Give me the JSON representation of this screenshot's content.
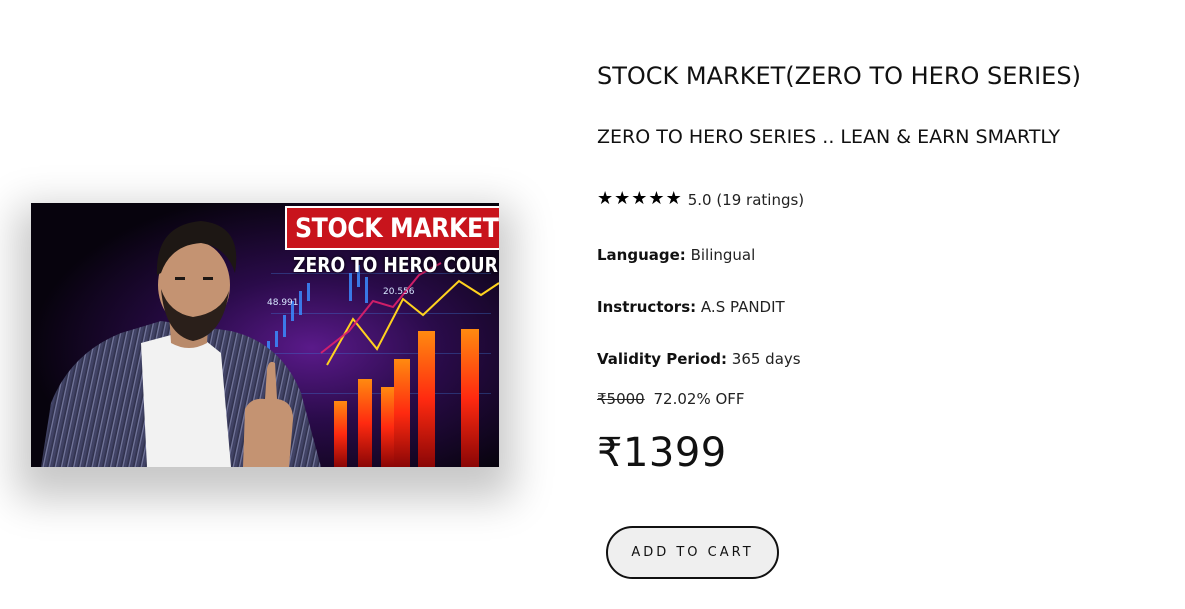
{
  "thumbnail": {
    "title": "STOCK MARKET",
    "subtitle": "ZERO TO HERO COURSE",
    "chart_numbers": [
      "48.991",
      "20.556"
    ],
    "colors": {
      "title_bg": "#c8141c",
      "background": "#0a0514",
      "bars": "#ff3a12",
      "line": "#ffd21e"
    }
  },
  "course": {
    "title": "STOCK MARKET(ZERO TO HERO SERIES)",
    "subtitle": "ZERO TO HERO SERIES .. LEAN & EARN SMARTLY",
    "rating": {
      "stars": 5,
      "text": "5.0 (19 ratings)",
      "star_icon": "★"
    },
    "language": {
      "label": "Language:",
      "value": "Bilingual"
    },
    "instructors": {
      "label": "Instructors:",
      "value": "A.S PANDIT"
    },
    "validity": {
      "label": "Validity Period:",
      "value": "365 days"
    },
    "original_price": "₹5000",
    "discount": "72.02% OFF",
    "price": "₹1399",
    "add_to_cart_label": "Add to cart"
  }
}
